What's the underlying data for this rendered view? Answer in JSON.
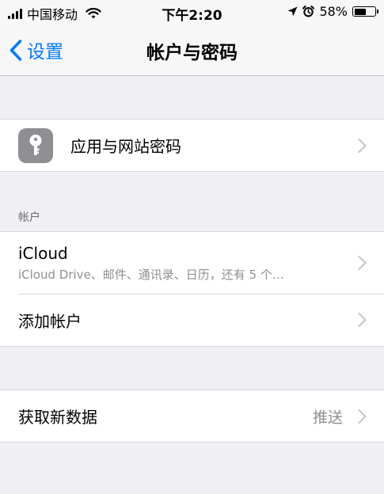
{
  "status_bar": {
    "carrier": "中国移动",
    "time": "下午2:20",
    "battery_percent": "58%",
    "battery_level": 0.58,
    "icons": [
      "signal-icon",
      "wifi-icon",
      "location-icon",
      "alarm-icon",
      "battery-icon"
    ]
  },
  "nav": {
    "back_label": "设置",
    "title": "帐户与密码"
  },
  "passwords_row": {
    "label": "应用与网站密码",
    "icon": "key-icon"
  },
  "accounts_section": {
    "header": "帐户",
    "icloud_title": "iCloud",
    "icloud_subtitle": "iCloud Drive、邮件、通讯录、日历，还有 5 个…",
    "add_account_label": "添加帐户"
  },
  "fetch_row": {
    "label": "获取新数据",
    "value": "推送"
  },
  "colors": {
    "accent": "#007aff",
    "background": "#efeff4",
    "secondary_text": "#8e8e93",
    "chevron": "#c7c7cc"
  }
}
